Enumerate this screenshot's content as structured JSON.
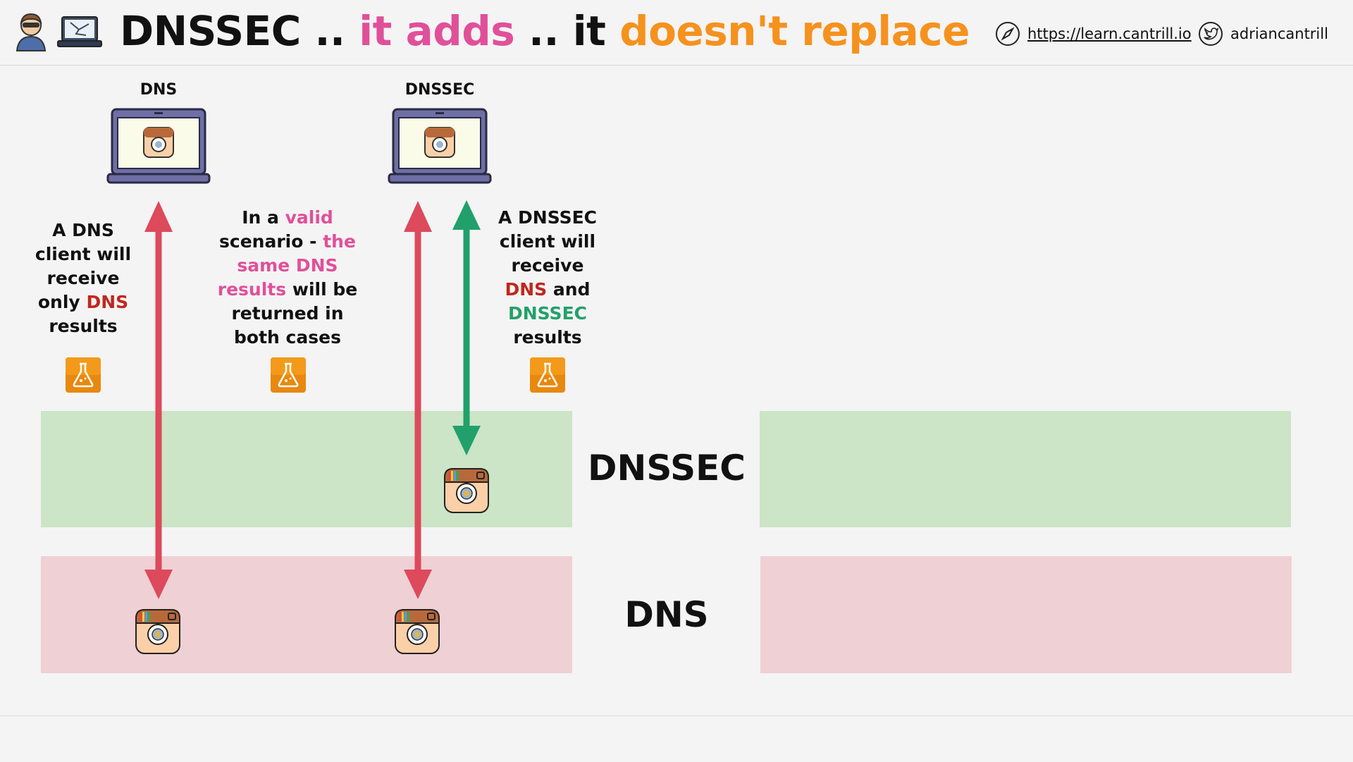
{
  "header": {
    "title_part1": "DNSSEC ..",
    "title_part2": "it adds",
    "title_part3": ".. it",
    "title_part4": "doesn't replace",
    "link_text": "https://learn.cantrill.io",
    "twitter_handle": "adriancantrill"
  },
  "columns": {
    "dns_label": "DNS",
    "dnssec_label": "DNSSEC"
  },
  "notes": {
    "left": {
      "line1": "A DNS",
      "line2": "client will",
      "line3": "receive",
      "line4_prefix": "only",
      "line4_highlight": "DNS",
      "line5": "results"
    },
    "middle": {
      "line1_prefix": "In a",
      "line1_highlight": "valid",
      "line2_prefix": "scenario -",
      "line2_highlight": "the",
      "line3": "same DNS",
      "line4_highlight": "results",
      "line4_suffix": "will be",
      "line5": "returned in",
      "line6": "both cases"
    },
    "right": {
      "line1": "A DNSSEC",
      "line2": "client will",
      "line3": "receive",
      "line4_highlight": "DNS",
      "line4_suffix": "and",
      "line5_highlight": "DNSSEC",
      "line6": "results"
    }
  },
  "bands": {
    "dnssec_label": "DNSSEC",
    "dns_label": "DNS"
  },
  "icons": {
    "avatar": "person-avatar-icon",
    "logo": "cracked-laptop-icon",
    "compass": "compass-icon",
    "twitter": "twitter-icon",
    "laptop": "laptop-icon",
    "app": "instagram-icon",
    "flask": "flask-icon"
  },
  "colors": {
    "pink_accent": "#e0509a",
    "orange_accent": "#f5921e",
    "dns_red": "#c0271e",
    "dnssec_green": "#24a06b",
    "arrow_red": "#dc4a5c",
    "arrow_green": "#21a06c",
    "band_green": "#cbe5c6",
    "band_pink": "#efd0d4"
  }
}
